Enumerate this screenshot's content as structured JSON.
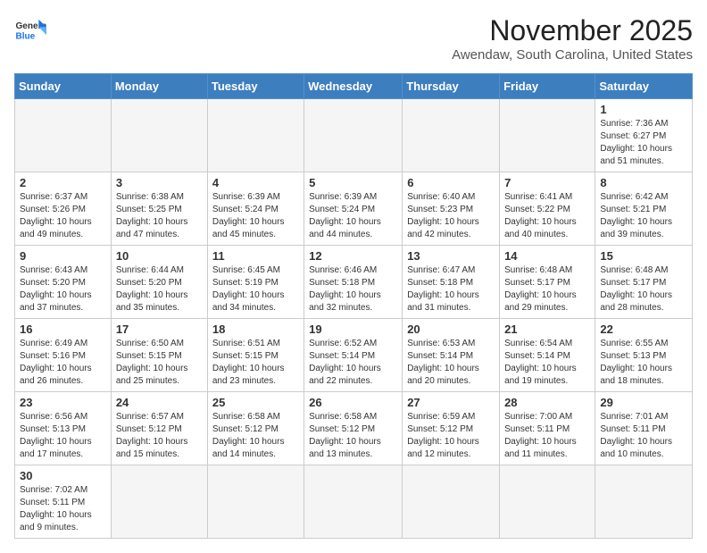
{
  "header": {
    "logo_general": "General",
    "logo_blue": "Blue",
    "month_title": "November 2025",
    "location": "Awendaw, South Carolina, United States"
  },
  "weekdays": [
    "Sunday",
    "Monday",
    "Tuesday",
    "Wednesday",
    "Thursday",
    "Friday",
    "Saturday"
  ],
  "days": [
    {
      "num": "",
      "sunrise": "",
      "sunset": "",
      "daylight": "",
      "empty": true
    },
    {
      "num": "",
      "sunrise": "",
      "sunset": "",
      "daylight": "",
      "empty": true
    },
    {
      "num": "",
      "sunrise": "",
      "sunset": "",
      "daylight": "",
      "empty": true
    },
    {
      "num": "",
      "sunrise": "",
      "sunset": "",
      "daylight": "",
      "empty": true
    },
    {
      "num": "",
      "sunrise": "",
      "sunset": "",
      "daylight": "",
      "empty": true
    },
    {
      "num": "",
      "sunrise": "",
      "sunset": "",
      "daylight": "",
      "empty": true
    },
    {
      "num": "1",
      "sunrise": "Sunrise: 7:36 AM",
      "sunset": "Sunset: 6:27 PM",
      "daylight": "Daylight: 10 hours and 51 minutes.",
      "empty": false
    },
    {
      "num": "2",
      "sunrise": "Sunrise: 6:37 AM",
      "sunset": "Sunset: 5:26 PM",
      "daylight": "Daylight: 10 hours and 49 minutes.",
      "empty": false
    },
    {
      "num": "3",
      "sunrise": "Sunrise: 6:38 AM",
      "sunset": "Sunset: 5:25 PM",
      "daylight": "Daylight: 10 hours and 47 minutes.",
      "empty": false
    },
    {
      "num": "4",
      "sunrise": "Sunrise: 6:39 AM",
      "sunset": "Sunset: 5:24 PM",
      "daylight": "Daylight: 10 hours and 45 minutes.",
      "empty": false
    },
    {
      "num": "5",
      "sunrise": "Sunrise: 6:39 AM",
      "sunset": "Sunset: 5:24 PM",
      "daylight": "Daylight: 10 hours and 44 minutes.",
      "empty": false
    },
    {
      "num": "6",
      "sunrise": "Sunrise: 6:40 AM",
      "sunset": "Sunset: 5:23 PM",
      "daylight": "Daylight: 10 hours and 42 minutes.",
      "empty": false
    },
    {
      "num": "7",
      "sunrise": "Sunrise: 6:41 AM",
      "sunset": "Sunset: 5:22 PM",
      "daylight": "Daylight: 10 hours and 40 minutes.",
      "empty": false
    },
    {
      "num": "8",
      "sunrise": "Sunrise: 6:42 AM",
      "sunset": "Sunset: 5:21 PM",
      "daylight": "Daylight: 10 hours and 39 minutes.",
      "empty": false
    },
    {
      "num": "9",
      "sunrise": "Sunrise: 6:43 AM",
      "sunset": "Sunset: 5:20 PM",
      "daylight": "Daylight: 10 hours and 37 minutes.",
      "empty": false
    },
    {
      "num": "10",
      "sunrise": "Sunrise: 6:44 AM",
      "sunset": "Sunset: 5:20 PM",
      "daylight": "Daylight: 10 hours and 35 minutes.",
      "empty": false
    },
    {
      "num": "11",
      "sunrise": "Sunrise: 6:45 AM",
      "sunset": "Sunset: 5:19 PM",
      "daylight": "Daylight: 10 hours and 34 minutes.",
      "empty": false
    },
    {
      "num": "12",
      "sunrise": "Sunrise: 6:46 AM",
      "sunset": "Sunset: 5:18 PM",
      "daylight": "Daylight: 10 hours and 32 minutes.",
      "empty": false
    },
    {
      "num": "13",
      "sunrise": "Sunrise: 6:47 AM",
      "sunset": "Sunset: 5:18 PM",
      "daylight": "Daylight: 10 hours and 31 minutes.",
      "empty": false
    },
    {
      "num": "14",
      "sunrise": "Sunrise: 6:48 AM",
      "sunset": "Sunset: 5:17 PM",
      "daylight": "Daylight: 10 hours and 29 minutes.",
      "empty": false
    },
    {
      "num": "15",
      "sunrise": "Sunrise: 6:48 AM",
      "sunset": "Sunset: 5:17 PM",
      "daylight": "Daylight: 10 hours and 28 minutes.",
      "empty": false
    },
    {
      "num": "16",
      "sunrise": "Sunrise: 6:49 AM",
      "sunset": "Sunset: 5:16 PM",
      "daylight": "Daylight: 10 hours and 26 minutes.",
      "empty": false
    },
    {
      "num": "17",
      "sunrise": "Sunrise: 6:50 AM",
      "sunset": "Sunset: 5:15 PM",
      "daylight": "Daylight: 10 hours and 25 minutes.",
      "empty": false
    },
    {
      "num": "18",
      "sunrise": "Sunrise: 6:51 AM",
      "sunset": "Sunset: 5:15 PM",
      "daylight": "Daylight: 10 hours and 23 minutes.",
      "empty": false
    },
    {
      "num": "19",
      "sunrise": "Sunrise: 6:52 AM",
      "sunset": "Sunset: 5:14 PM",
      "daylight": "Daylight: 10 hours and 22 minutes.",
      "empty": false
    },
    {
      "num": "20",
      "sunrise": "Sunrise: 6:53 AM",
      "sunset": "Sunset: 5:14 PM",
      "daylight": "Daylight: 10 hours and 20 minutes.",
      "empty": false
    },
    {
      "num": "21",
      "sunrise": "Sunrise: 6:54 AM",
      "sunset": "Sunset: 5:14 PM",
      "daylight": "Daylight: 10 hours and 19 minutes.",
      "empty": false
    },
    {
      "num": "22",
      "sunrise": "Sunrise: 6:55 AM",
      "sunset": "Sunset: 5:13 PM",
      "daylight": "Daylight: 10 hours and 18 minutes.",
      "empty": false
    },
    {
      "num": "23",
      "sunrise": "Sunrise: 6:56 AM",
      "sunset": "Sunset: 5:13 PM",
      "daylight": "Daylight: 10 hours and 17 minutes.",
      "empty": false
    },
    {
      "num": "24",
      "sunrise": "Sunrise: 6:57 AM",
      "sunset": "Sunset: 5:12 PM",
      "daylight": "Daylight: 10 hours and 15 minutes.",
      "empty": false
    },
    {
      "num": "25",
      "sunrise": "Sunrise: 6:58 AM",
      "sunset": "Sunset: 5:12 PM",
      "daylight": "Daylight: 10 hours and 14 minutes.",
      "empty": false
    },
    {
      "num": "26",
      "sunrise": "Sunrise: 6:58 AM",
      "sunset": "Sunset: 5:12 PM",
      "daylight": "Daylight: 10 hours and 13 minutes.",
      "empty": false
    },
    {
      "num": "27",
      "sunrise": "Sunrise: 6:59 AM",
      "sunset": "Sunset: 5:12 PM",
      "daylight": "Daylight: 10 hours and 12 minutes.",
      "empty": false
    },
    {
      "num": "28",
      "sunrise": "Sunrise: 7:00 AM",
      "sunset": "Sunset: 5:11 PM",
      "daylight": "Daylight: 10 hours and 11 minutes.",
      "empty": false
    },
    {
      "num": "29",
      "sunrise": "Sunrise: 7:01 AM",
      "sunset": "Sunset: 5:11 PM",
      "daylight": "Daylight: 10 hours and 10 minutes.",
      "empty": false
    },
    {
      "num": "30",
      "sunrise": "Sunrise: 7:02 AM",
      "sunset": "Sunset: 5:11 PM",
      "daylight": "Daylight: 10 hours and 9 minutes.",
      "empty": false
    },
    {
      "num": "",
      "sunrise": "",
      "sunset": "",
      "daylight": "",
      "empty": true
    },
    {
      "num": "",
      "sunrise": "",
      "sunset": "",
      "daylight": "",
      "empty": true
    },
    {
      "num": "",
      "sunrise": "",
      "sunset": "",
      "daylight": "",
      "empty": true
    },
    {
      "num": "",
      "sunrise": "",
      "sunset": "",
      "daylight": "",
      "empty": true
    },
    {
      "num": "",
      "sunrise": "",
      "sunset": "",
      "daylight": "",
      "empty": true
    }
  ]
}
